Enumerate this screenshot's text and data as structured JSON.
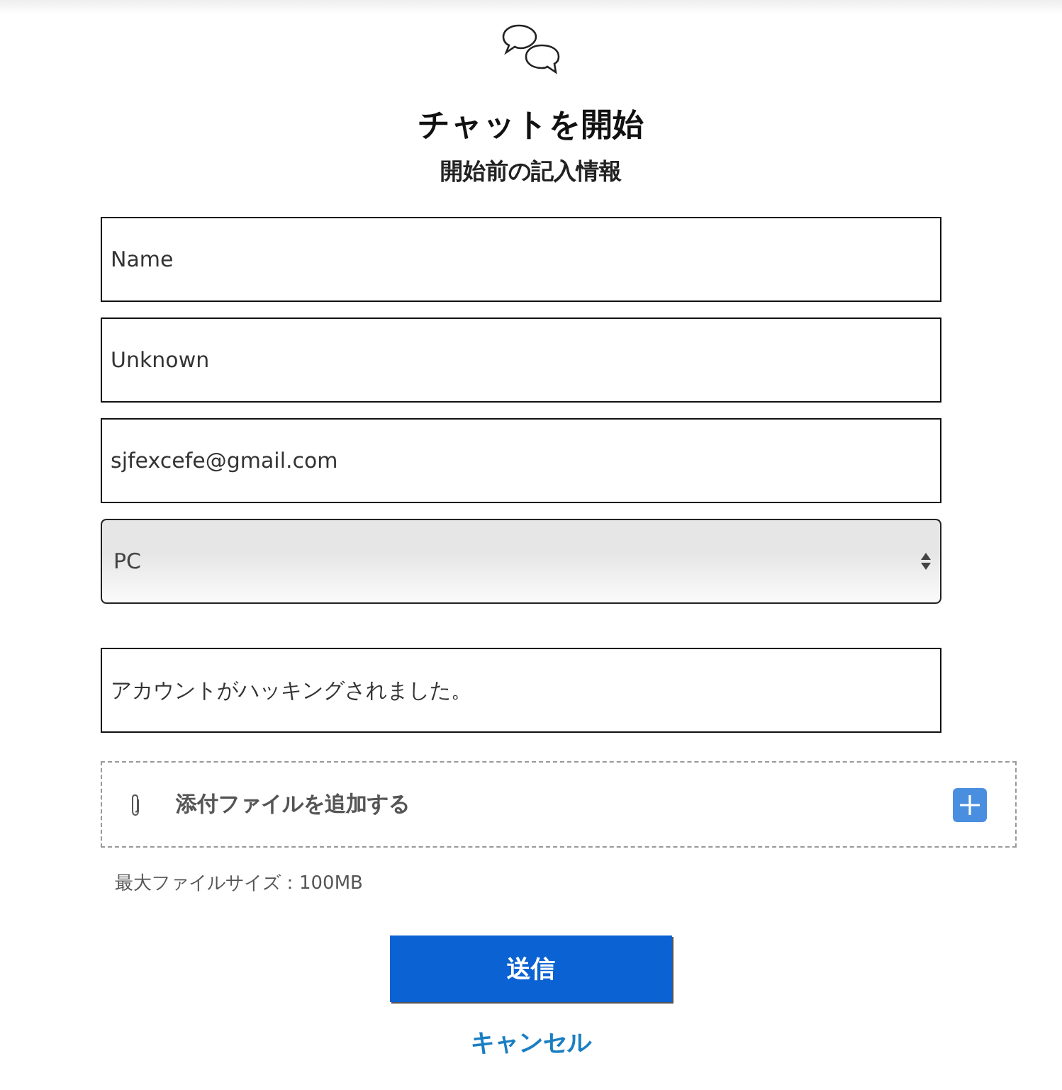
{
  "header": {
    "title": "チャットを開始",
    "subtitle": "開始前の記入情報"
  },
  "fields": [
    {
      "kind": "text",
      "value": "Name"
    },
    {
      "kind": "text",
      "value": "Unknown"
    },
    {
      "kind": "text",
      "value": "sjfexcefe@gmail.com"
    },
    {
      "kind": "select",
      "value": "PC"
    },
    {
      "kind": "text",
      "value": "アカウントがハッキングされました。"
    }
  ],
  "attachment": {
    "label": "添付ファイルを追加する",
    "note": "最大ファイルサイズ：100MB"
  },
  "submit": "送信",
  "cancel": "キャンセル"
}
